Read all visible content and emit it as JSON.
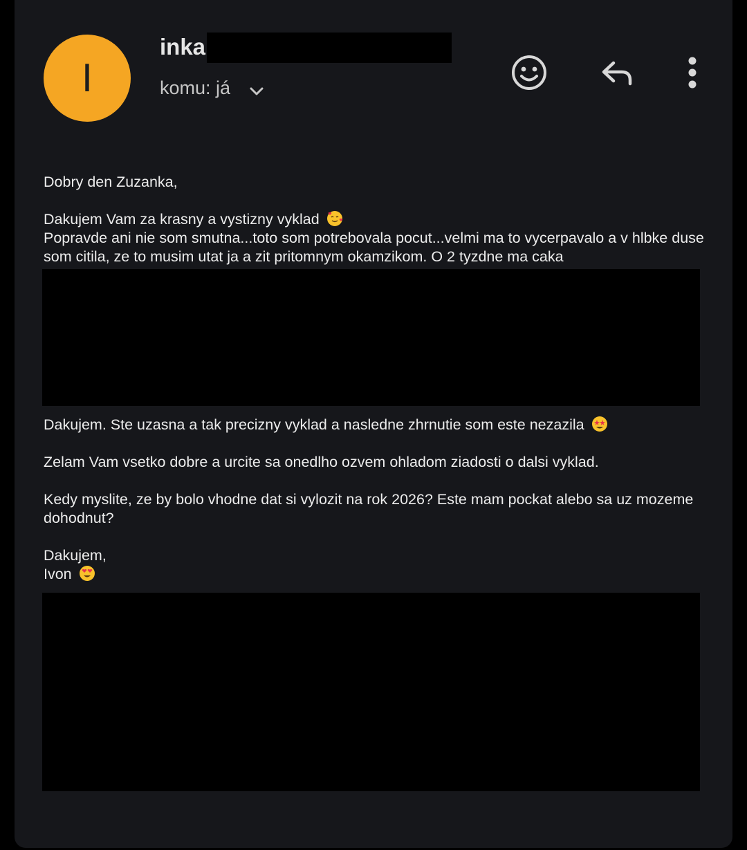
{
  "header": {
    "avatar_letter": "I",
    "sender_name": "inka",
    "recipient": "komu: já",
    "icons": {
      "avatar_color": "#f5a623",
      "emoji": "smiley-face-icon",
      "reply": "reply-arrow-icon",
      "more": "more-vertical-icon",
      "expand": "chevron-down-icon"
    }
  },
  "message": {
    "greeting": "Dobry den Zuzanka,",
    "p1_line1": "Dakujem Vam za krasny a vystizny vyklad",
    "p1_line1_emoji": "smiling-face-with-hearts",
    "p1_line2": "Popravde ani nie som smutna...toto som potrebovala pocut...velmi ma to vycerpavalo a v hlbke duse som citila, ze to musim utat ja a zit pritomnym okamzikom. O 2 tyzdne ma caka",
    "p2": "Dakujem. Ste uzasna a tak precizny vyklad a nasledne zhrnutie som este nezazila",
    "p2_emoji": "star-struck",
    "p3": "Zelam Vam vsetko dobre a urcite sa onedlho ozvem ohladom ziadosti o dalsi vyklad.",
    "p4": "Kedy myslite, ze by bolo vhodne dat si vylozit na rok 2026? Este mam pockat alebo sa uz mozeme dohodnut?",
    "closing": "Dakujem,",
    "signature": "Ivon",
    "signature_emoji": "heart-eyes"
  }
}
